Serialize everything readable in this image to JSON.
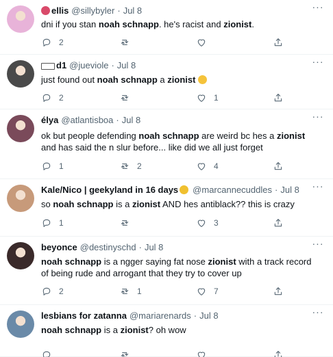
{
  "tweets": [
    {
      "name": "ellis",
      "handle": "@sillybyler",
      "sep": "·",
      "time": "Jul 8",
      "body": [
        {
          "t": "dni if you stan ",
          "b": false
        },
        {
          "t": "noah schnapp",
          "b": true
        },
        {
          "t": ". he's racist and ",
          "b": false
        },
        {
          "t": "zionist",
          "b": true
        },
        {
          "t": ".",
          "b": false
        }
      ],
      "replies": "2",
      "retweets": "",
      "likes": "",
      "avatar_color": "#e8b3d9"
    },
    {
      "name": "d1",
      "handle": "@jueviole",
      "sep": "·",
      "time": "Jul 8",
      "body": [
        {
          "t": "just found out ",
          "b": false
        },
        {
          "t": "noah schnapp",
          "b": true
        },
        {
          "t": " a ",
          "b": false
        },
        {
          "t": "zionist",
          "b": true
        },
        {
          "t": " ",
          "b": false
        }
      ],
      "replies": "2",
      "retweets": "",
      "likes": "1",
      "avatar_color": "#4a4a4a"
    },
    {
      "name": "élya",
      "handle": "@atlantisboa",
      "sep": "·",
      "time": "Jul 8",
      "body": [
        {
          "t": "ok but people defending ",
          "b": false
        },
        {
          "t": "noah schnapp",
          "b": true
        },
        {
          "t": " are weird bc hes a ",
          "b": false
        },
        {
          "t": "zionist",
          "b": true
        },
        {
          "t": " and has said the n slur before... like did we all just forget",
          "b": false
        }
      ],
      "replies": "1",
      "retweets": "2",
      "likes": "4",
      "avatar_color": "#7a4a5a"
    },
    {
      "name": "Kale/Nico | geekyland in 16 days",
      "handle": "@marcannecuddles",
      "sep": "·",
      "time": "Jul 8",
      "body": [
        {
          "t": "so ",
          "b": false
        },
        {
          "t": "noah schnapp",
          "b": true
        },
        {
          "t": " is a ",
          "b": false
        },
        {
          "t": "zionist",
          "b": true
        },
        {
          "t": " AND hes antiblack?? this is crazy",
          "b": false
        }
      ],
      "replies": "1",
      "retweets": "",
      "likes": "3",
      "avatar_color": "#c79a7a"
    },
    {
      "name": "beyonce",
      "handle": "@destinyschd",
      "sep": "·",
      "time": "Jul 8",
      "body": [
        {
          "t": "noah schnapp",
          "b": true
        },
        {
          "t": " is a ngger saying fat nose ",
          "b": false
        },
        {
          "t": "zionist",
          "b": true
        },
        {
          "t": " with a track record of being rude and arrogant that they try to cover up",
          "b": false
        }
      ],
      "replies": "2",
      "retweets": "1",
      "likes": "7",
      "avatar_color": "#3a2a2a"
    },
    {
      "name": "lesbians for zatanna",
      "handle": "@mariarenards",
      "sep": "·",
      "time": "Jul 8",
      "body": [
        {
          "t": "noah schnapp",
          "b": true
        },
        {
          "t": " is a ",
          "b": false
        },
        {
          "t": "zionist",
          "b": true
        },
        {
          "t": "? oh wow",
          "b": false
        }
      ],
      "replies": "",
      "retweets": "",
      "likes": "",
      "avatar_color": "#6a8aa8"
    }
  ]
}
